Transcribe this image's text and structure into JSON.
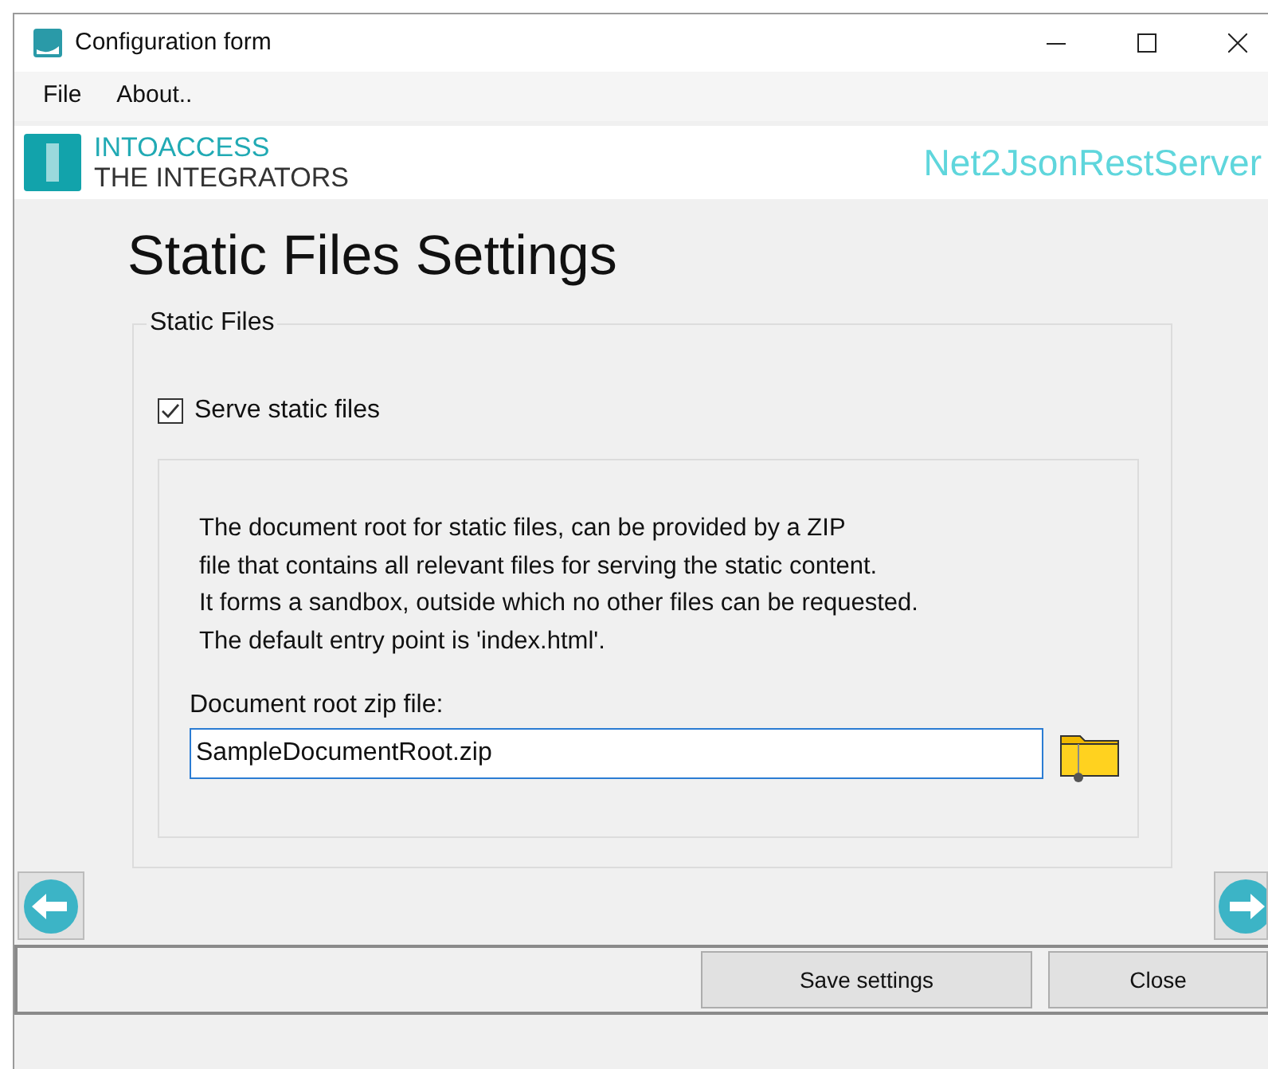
{
  "window": {
    "title": "Configuration form"
  },
  "menu": [
    {
      "label": "File"
    },
    {
      "label": "About.."
    }
  ],
  "logo": {
    "line_1": "INTOACCESS",
    "line_2": "THE INTEGRATORS"
  },
  "product": "Net2JsonRestServer",
  "heading": "Static Files Settings",
  "group": {
    "title": "Static Files",
    "serve": {
      "label": "Serve static files",
      "checked": true
    },
    "description": [
      "The document root for static files, can be provided by a ZIP",
      "file that contains all relevant files for serving the static content.",
      "It forms a sandbox, outside which no other files can be requested.",
      "The default entry point is 'index.html'."
    ],
    "zip_label": "Document root zip file:",
    "zip_value": "SampleDocumentRoot.zip"
  },
  "buttons": [
    {
      "label": "Save settings"
    },
    {
      "label": "Close"
    }
  ]
}
